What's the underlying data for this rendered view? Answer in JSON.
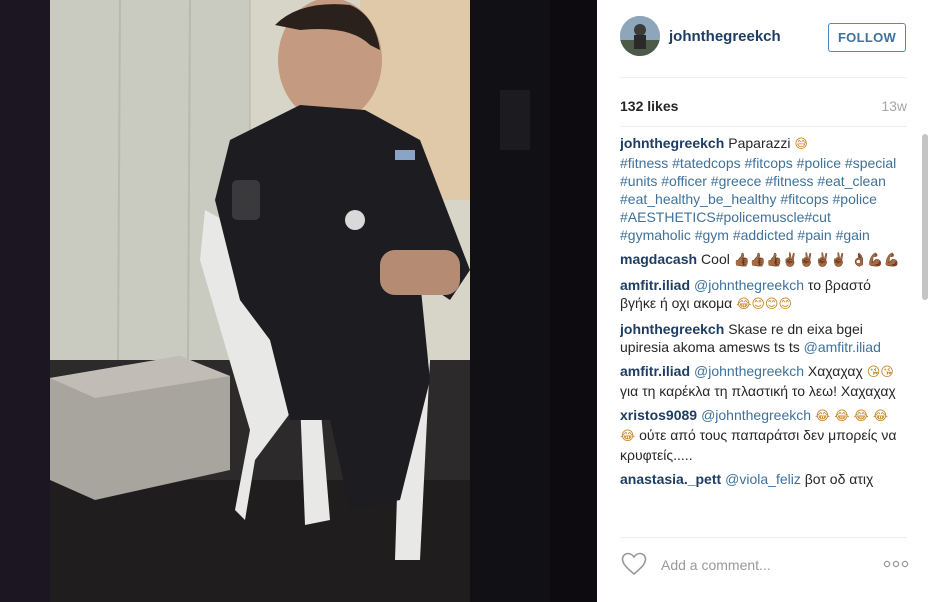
{
  "post": {
    "username": "johnthegreekch",
    "follow_label": "FOLLOW",
    "likes": "132 likes",
    "time": "13w"
  },
  "caption": {
    "username": "johnthegreekch",
    "text": "Paparazzi",
    "emoji": "😅",
    "hashtags": "#fitness #tatedcops #fitcops #police #special #units #officer #greece #fitness #eat_clean #eat_healthy_be_healthy #fitcops #police #AESTHETICS#policemuscle#cut #gymaholic #gym #addicted #pain #gain"
  },
  "comments": [
    {
      "username": "magdacash",
      "mention": "",
      "text": "Cool",
      "emoji": "👍🏾👍🏾👍🏾✌🏾✌🏾✌🏾✌🏾 👌🏾💪🏾💪🏾",
      "text_after": "",
      "mention_after": ""
    },
    {
      "username": "amfitr.iliad",
      "mention": "@johnthegreekch",
      "text": "το βραστό βγήκε ή οχι ακομα",
      "emoji": "😂😊😊😊",
      "text_after": "",
      "mention_after": ""
    },
    {
      "username": "johnthegreekch",
      "mention": "",
      "text": "Skase re dn eixa bgei upiresia akoma amesws ts ts",
      "emoji": "",
      "text_after": "",
      "mention_after": "@amfitr.iliad"
    },
    {
      "username": "amfitr.iliad",
      "mention": "@johnthegreekch",
      "text": "Χαχαχαχ",
      "emoji": "😘😘",
      "text_after": "για τη καρέκλα τη πλαστική το λεω! Χαχαχαχ",
      "mention_after": ""
    },
    {
      "username": "xristos9089",
      "mention": "@johnthegreekch",
      "text": "",
      "emoji": "😂 😂 😂 😂 😂",
      "text_after": "ούτε από τους παπαράτσι δεν μπορείς να κρυφτείς.....",
      "mention_after": ""
    },
    {
      "username": "anastasia._pett",
      "mention": "@viola_feliz",
      "text": "βοτ οδ ατιχ",
      "emoji": "",
      "text_after": "",
      "mention_after": ""
    }
  ],
  "add_comment": {
    "placeholder": "Add a comment..."
  },
  "icons": {
    "heart": "heart-icon",
    "more": "more-options-icon"
  },
  "colors": {
    "username": "#1d3d63",
    "link": "#3f729b",
    "follow_border": "#4a88c7"
  }
}
